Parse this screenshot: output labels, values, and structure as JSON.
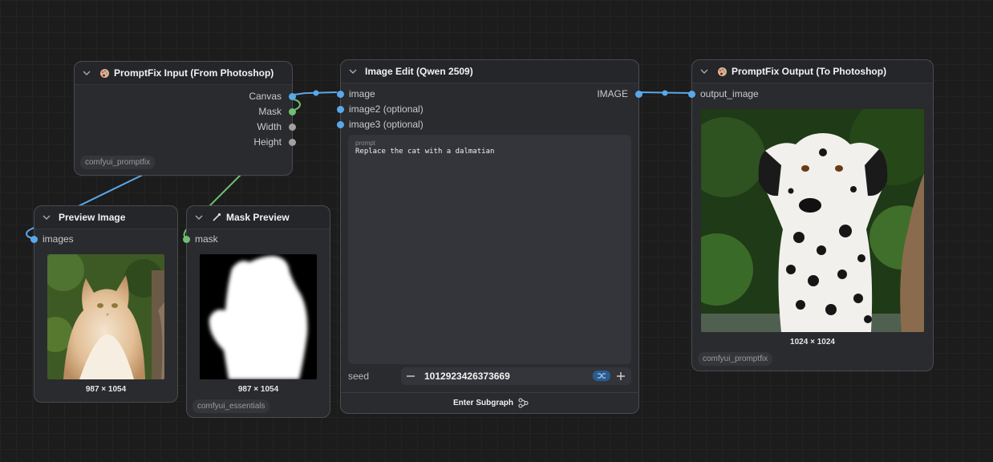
{
  "nodes": {
    "promptfix_input": {
      "title": "PromptFix Input (From Photoshop)",
      "outputs": [
        "Canvas",
        "Mask",
        "Width",
        "Height"
      ],
      "badge": "comfyui_promptfix"
    },
    "preview_image": {
      "title": "Preview Image",
      "input": "images",
      "dimensions": "987 × 1054"
    },
    "mask_preview": {
      "title": "Mask Preview",
      "input": "mask",
      "dimensions": "987 × 1054",
      "badge": "comfyui_essentials"
    },
    "image_edit": {
      "title": "Image Edit (Qwen 2509)",
      "inputs": [
        "image",
        "image2 (optional)",
        "image3 (optional)"
      ],
      "output": "IMAGE",
      "prompt_label": "prompt",
      "prompt_text": "Replace the cat with a dalmatian",
      "seed_label": "seed",
      "seed_value": "1012923426373669",
      "footer": "Enter Subgraph"
    },
    "promptfix_output": {
      "title": "PromptFix Output (To Photoshop)",
      "input": "output_image",
      "dimensions": "1024 × 1024",
      "badge": "comfyui_promptfix"
    }
  },
  "colors": {
    "image_wire": "#5aa8ea",
    "mask_wire": "#6fbf73",
    "number_socket": "#a0a0a0"
  },
  "icons": {
    "palette": "palette-icon",
    "chevron": "chevron-down-icon",
    "mask": "mask-tool-icon",
    "subgraph": "subgraph-icon",
    "randomize": "shuffle-icon"
  }
}
